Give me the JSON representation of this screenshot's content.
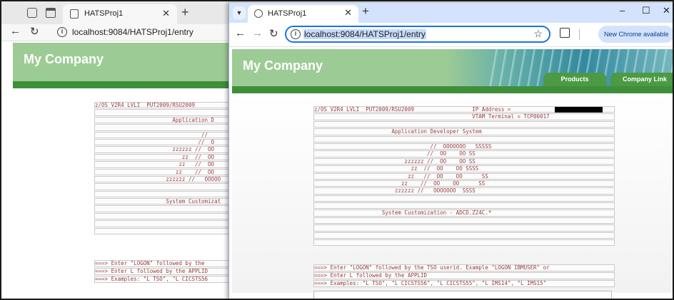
{
  "back_window": {
    "tab_title": "HATSProj1",
    "tab_close": "✕",
    "new_tab": "+",
    "address": "localhost:9084/HATSProj1/entry",
    "company": "My Company",
    "screen_lines": [
      "z/OS V2R4 LVLI  PUT2009/RSU2009",
      "",
      "                        Application D",
      "",
      "                                 //",
      "                                //  O",
      "                        zzzzzz //  OO",
      "                           zz  //  OO",
      "                          zz   //  OO",
      "                         zz    //  OO",
      "                      zzzzzz //   OOOOO",
      "",
      "",
      "                      System Customizat",
      "",
      "",
      "",
      ""
    ],
    "field_lines": [
      "===> Enter \"LOGON\" followed by the",
      "===> Enter L followed by the APPLID",
      "===> Examples: \"L TSO\", \"L CICSTS56"
    ]
  },
  "front_window": {
    "tab_title": "HATSProj1",
    "tab_close": "✕",
    "new_tab": "+",
    "address": "localhost:9084/HATSProj1/entry",
    "update_button": "New Chrome available",
    "company": "My Company",
    "nav_tabs": [
      "Products",
      "Company Link"
    ],
    "screen_lines": [
      "z/OS V2R4 LVLI  PUT2009/RSU2009                  IP Address = ",
      "                                                 VTAM Terminal = TCP00017",
      "",
      "                        Application Developer System",
      "",
      "                                    //  OOOOOOO   SSSSS",
      "                                   //  OO    OO SS",
      "                            zzzzzz //  OO    OO SS",
      "                              zz  //  OO    OO SSSS",
      "                             zz   //  OO    OO      SS",
      "                           zz    //  OO    OO      SS",
      "                         zzzzzz //   OOOOOOO  SSSS",
      "",
      "",
      "                     System Customization - ADCD.Z24C.*",
      "",
      "",
      "",
      ""
    ],
    "field_lines": [
      "===> Enter \"LOGON\" followed by the TSO userid. Example \"LOGON IBMUSER\" or",
      "===> Enter L followed by the APPLID",
      "===> Examples: \"L TSO\", \"L CICSTS56\", \"L CICSTS55\", \"L IMS14\", \"L IMS15\""
    ]
  }
}
